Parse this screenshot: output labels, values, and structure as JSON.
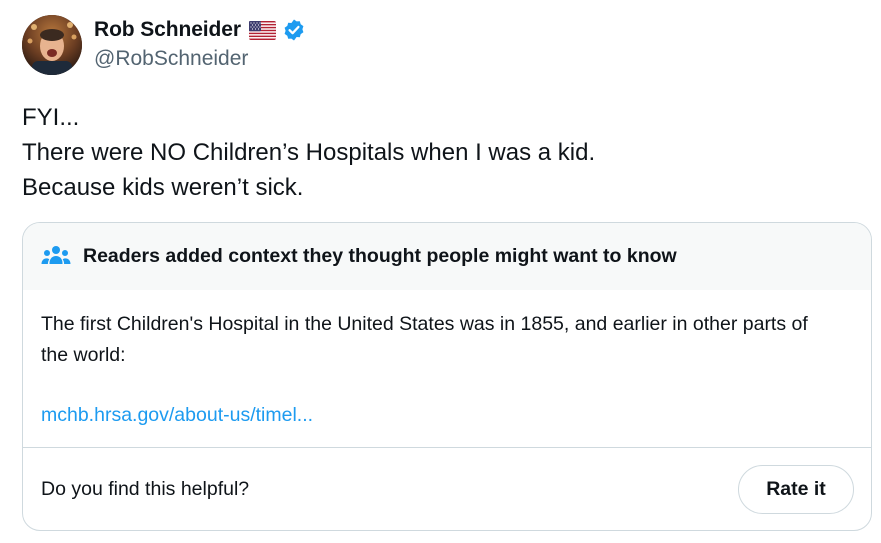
{
  "author": {
    "display_name": "Rob Schneider",
    "handle": "@RobSchneider",
    "flag_icon": "us-flag-icon",
    "verified_icon": "verified-badge-icon",
    "verified_color": "#1d9bf0"
  },
  "tweet": {
    "lines": [
      "FYI...",
      "There were NO Children’s Hospitals when I was a kid.",
      "Because kids weren’t sick."
    ]
  },
  "community_note": {
    "icon": "people-icon",
    "header": "Readers added context they thought people might want to know",
    "body": "The first Children's Hospital in the United States was in 1855, and earlier in other parts of the world:",
    "link": "mchb.hrsa.gov/about-us/timel...",
    "link_color": "#1d9bf0",
    "question": "Do you find this helpful?",
    "rate_button": "Rate it"
  }
}
